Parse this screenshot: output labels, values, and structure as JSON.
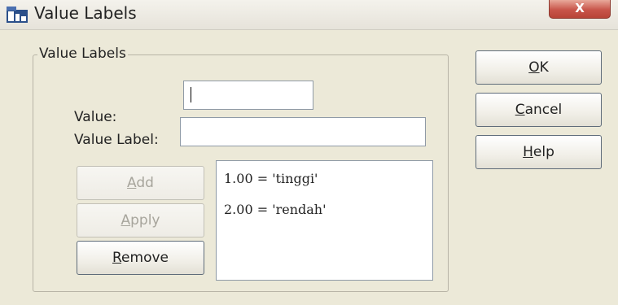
{
  "window": {
    "title": "Value Labels",
    "close_glyph": "X"
  },
  "group": {
    "legend": "Value Labels"
  },
  "fields": {
    "value_label_text": "Value:",
    "value_input": "",
    "value_label_label_text": "Value Label:",
    "value_label_input": ""
  },
  "buttons": {
    "add": "Add",
    "apply": "Apply",
    "remove": "Remove",
    "ok": "OK",
    "cancel": "Cancel",
    "help": "Help"
  },
  "list": {
    "items": [
      "1.00 = 'tinggi'",
      "2.00 = 'rendah'"
    ]
  },
  "colors": {
    "dialog_bg": "#ece9d8",
    "close_button": "#c8554a"
  }
}
